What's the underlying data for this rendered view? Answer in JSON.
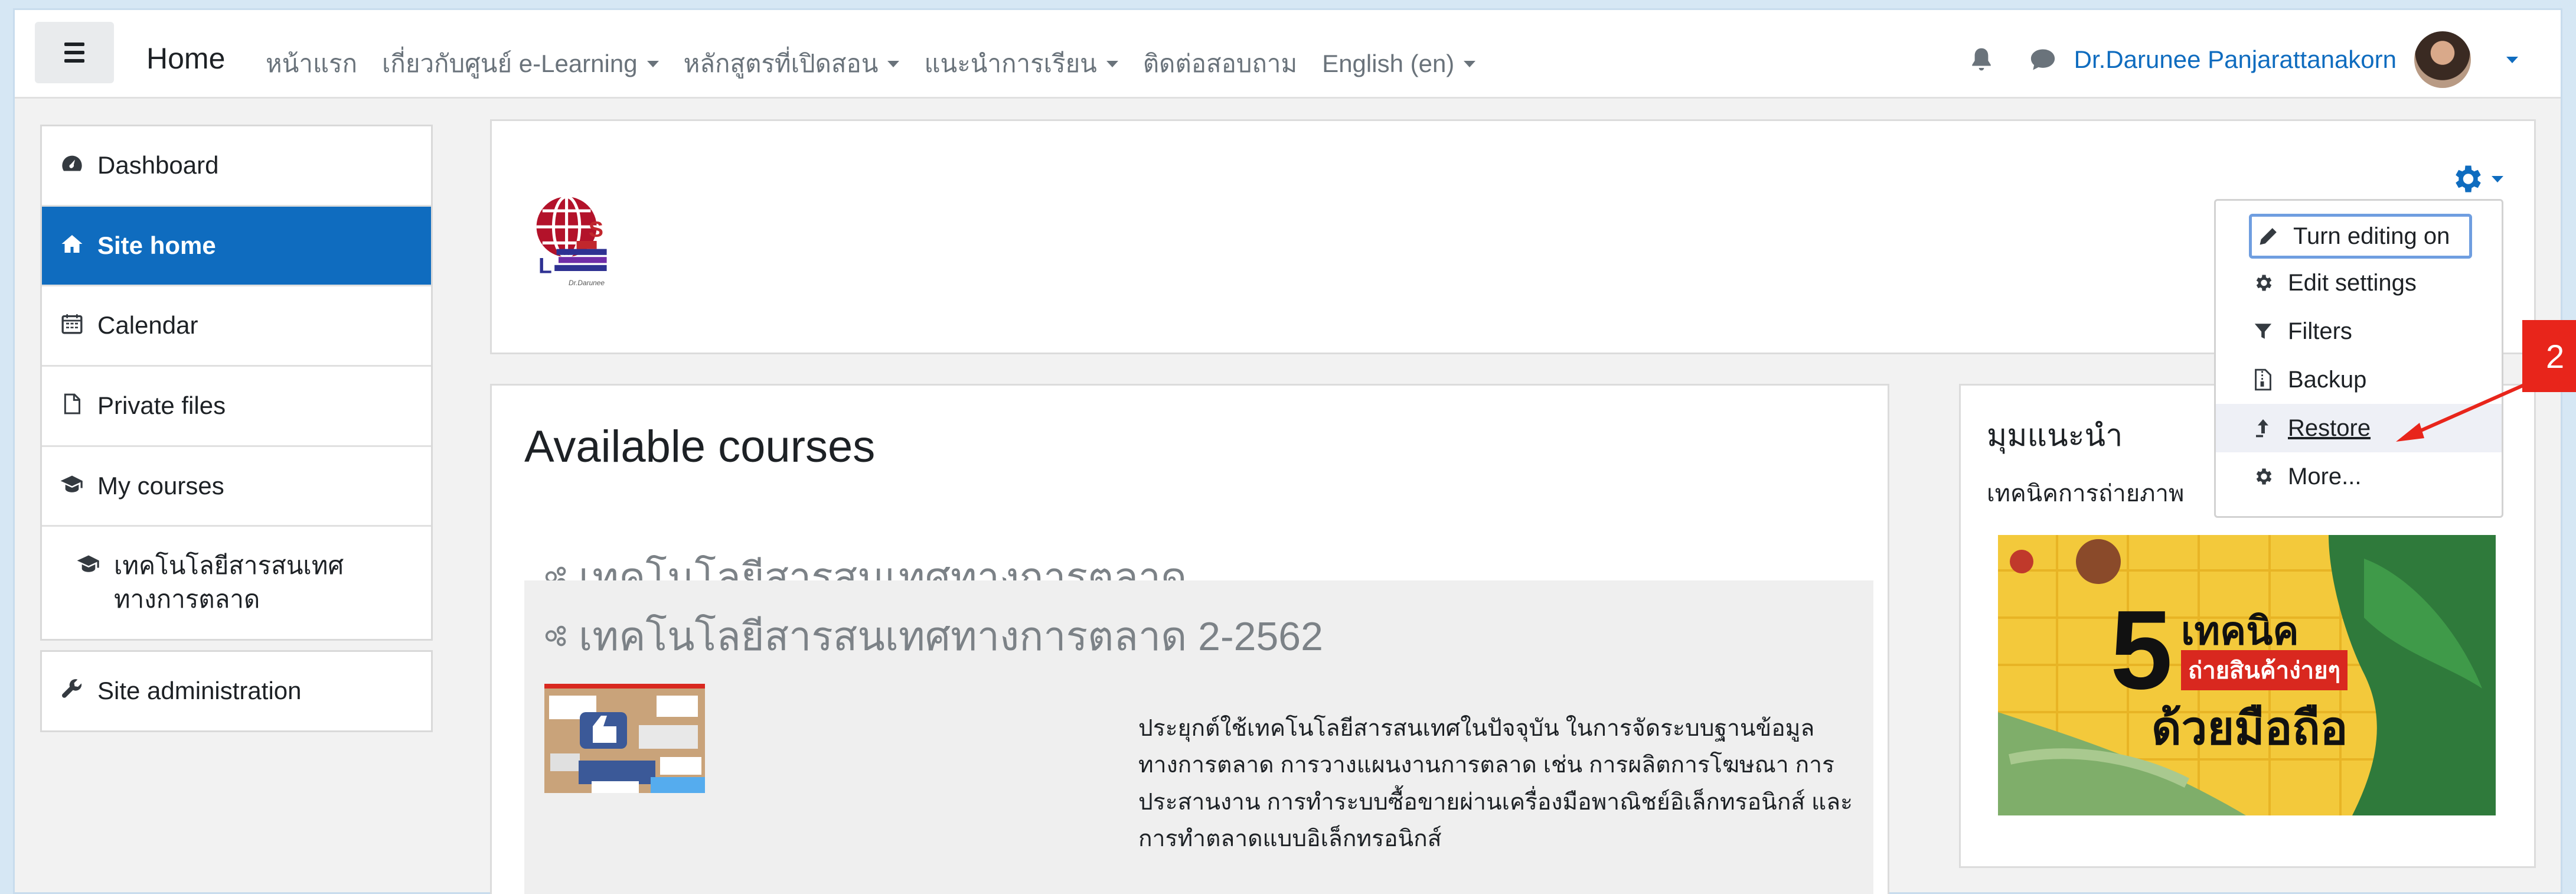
{
  "navbar": {
    "brand": "Home",
    "links": [
      {
        "label": "หน้าแรก",
        "dropdown": false
      },
      {
        "label": "เกี่ยวกับศูนย์ e-Learning",
        "dropdown": true
      },
      {
        "label": "หลักสูตรที่เปิดสอน",
        "dropdown": true
      },
      {
        "label": "แนะนำการเรียน",
        "dropdown": true
      },
      {
        "label": "ติดต่อสอบถาม",
        "dropdown": false
      },
      {
        "label": "English (en)",
        "dropdown": true
      }
    ],
    "user_name": "Dr.Darunee Panjarattanakorn",
    "icons": [
      "bell-icon",
      "chat-icon"
    ]
  },
  "sidebar": {
    "items": [
      {
        "label": "Dashboard",
        "icon": "dashboard-icon",
        "active": false
      },
      {
        "label": "Site home",
        "icon": "home-icon",
        "active": true
      },
      {
        "label": "Calendar",
        "icon": "calendar-icon",
        "active": false
      },
      {
        "label": "Private files",
        "icon": "file-icon",
        "active": false
      },
      {
        "label": "My courses",
        "icon": "graduation-cap-icon",
        "active": false
      },
      {
        "label": "เทคโนโลยีสารสนเทศทางการตลาด",
        "icon": "graduation-cap-icon",
        "active": false
      }
    ],
    "admin": {
      "label": "Site administration",
      "icon": "wrench-icon"
    }
  },
  "settings_menu": {
    "items": [
      {
        "label": "Turn editing on",
        "icon": "pencil-icon",
        "state": "focused"
      },
      {
        "label": "Edit settings",
        "icon": "gear-icon",
        "state": ""
      },
      {
        "label": "Filters",
        "icon": "filter-icon",
        "state": ""
      },
      {
        "label": "Backup",
        "icon": "file-archive-icon",
        "state": ""
      },
      {
        "label": "Restore",
        "icon": "upload-icon",
        "state": "hover"
      },
      {
        "label": "More...",
        "icon": "gear-icon",
        "state": ""
      }
    ]
  },
  "main": {
    "title": "Available courses",
    "courses": [
      {
        "name": "เทคโนโลยีสารสนเทศทางการตลาด"
      },
      {
        "name": "เทคโนโลยีสารสนเทศทางการตลาด 2-2562",
        "summary": "ประยุกต์ใช้เทคโนโลยีสารสนเทศในปัจจุบัน ในการจัดระบบฐานข้อมูลทางการตลาด การวางแผนงานการตลาด เช่น การผลิตการโฆษณา การประสานงาน การทำระบบซื้อขายผ่านเครื่องมือพาณิชย์อิเล็กทรอนิกส์ และการทำตลาดแบบอิเล็กทรอนิกส์"
      }
    ]
  },
  "right_block": {
    "title": "มุมแนะนำ",
    "subtitle": "เทคนิคการถ่ายภาพ",
    "banner": {
      "number": "5",
      "line1": "เทคนิค",
      "line2": "ถ่ายสินค้าง่ายๆ",
      "line3": "ด้วยมือถือ"
    }
  },
  "annotation": {
    "marker": "2"
  },
  "colors": {
    "primary": "#0f6cbf",
    "marker": "#e8251b"
  }
}
